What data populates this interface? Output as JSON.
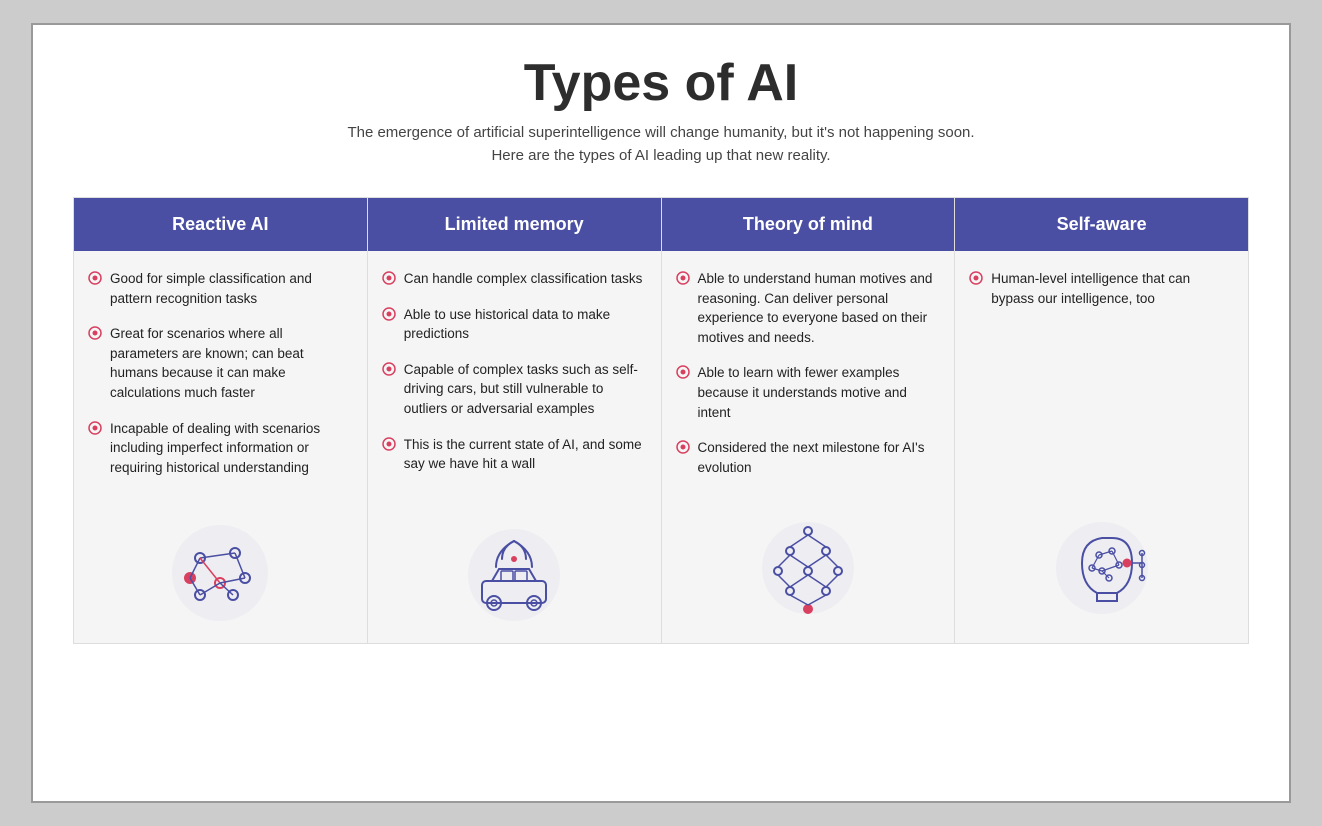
{
  "page": {
    "title": "Types of AI",
    "subtitle_line1": "The emergence of artificial superintelligence will change humanity, but it's not happening soon.",
    "subtitle_line2": "Here are the types of AI leading up that new reality."
  },
  "columns": [
    {
      "id": "reactive-ai",
      "header": "Reactive AI",
      "bullets": [
        "Good for simple classification and pattern recognition tasks",
        "Great for scenarios where all parameters are known; can beat humans because it can make calculations much faster",
        "Incapable of dealing with scenarios including imperfect information or requiring historical understanding"
      ],
      "icon": "network"
    },
    {
      "id": "limited-memory",
      "header": "Limited memory",
      "bullets": [
        "Can handle complex classification tasks",
        "Able to use historical data to make predictions",
        "Capable of complex tasks such as self-driving cars, but still vulnerable to outliers or adversarial examples",
        "This is the current state of AI, and some say we have hit a wall"
      ],
      "icon": "car"
    },
    {
      "id": "theory-of-mind",
      "header": "Theory of mind",
      "bullets": [
        "Able to understand human motives and reasoning. Can deliver personal experience to everyone based on their motives and needs.",
        "Able to learn with fewer examples because it understands motive and intent",
        "Considered the next milestone for AI's evolution"
      ],
      "icon": "neural"
    },
    {
      "id": "self-aware",
      "header": "Self-aware",
      "bullets": [
        "Human-level intelligence that can bypass our intelligence, too"
      ],
      "icon": "head"
    }
  ]
}
